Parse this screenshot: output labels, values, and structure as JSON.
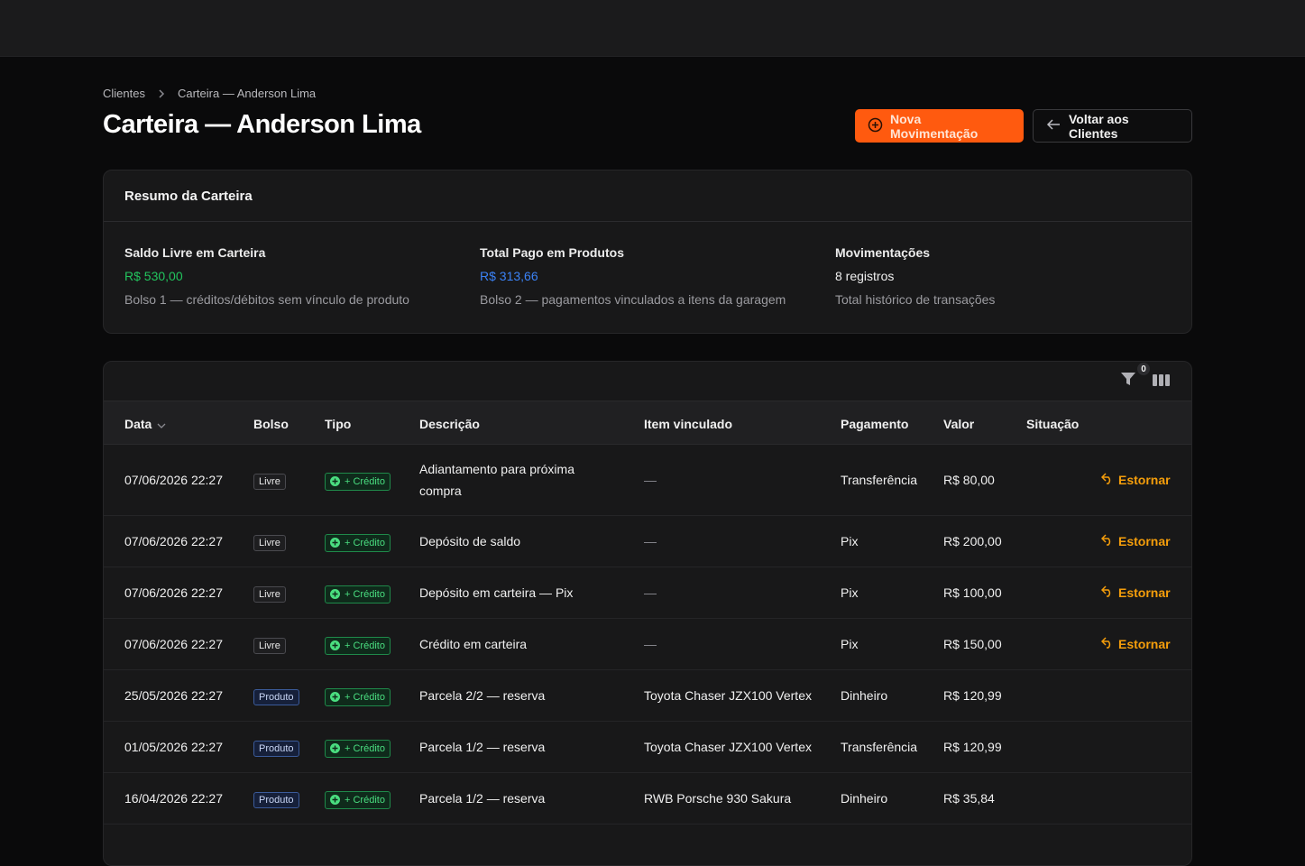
{
  "breadcrumb": {
    "root": "Clientes",
    "current": "Carteira — Anderson Lima"
  },
  "page_title": "Carteira — Anderson Lima",
  "actions": {
    "new_label": "Nova Movimentação",
    "back_label": "Voltar aos Clientes"
  },
  "summary": {
    "title": "Resumo da Carteira",
    "cols": [
      {
        "label": "Saldo Livre em Carteira",
        "value": "R$ 530,00",
        "desc": "Bolso 1 — créditos/débitos sem vínculo de produto"
      },
      {
        "label": "Total Pago em Produtos",
        "value": "R$ 313,66",
        "desc": "Bolso 2 — pagamentos vinculados a itens da garagem"
      },
      {
        "label": "Movimentações",
        "value": "8 registros",
        "desc": "Total histórico de transações"
      }
    ]
  },
  "toolbar": {
    "filter_count": "0"
  },
  "table": {
    "headers": [
      "Data",
      "Bolso",
      "Tipo",
      "Descrição",
      "Item vinculado",
      "Pagamento",
      "Valor",
      "Situação"
    ],
    "rows": [
      {
        "date": "07/06/2026 22:27",
        "bolso": "Livre",
        "tipo": "+ Crédito",
        "desc1": "Adiantamento para próxima",
        "desc2": "compra",
        "item": "—",
        "pagamento": "Transferência",
        "valor": "R$ 80,00",
        "action": "Estornar"
      },
      {
        "date": "07/06/2026 22:27",
        "bolso": "Livre",
        "tipo": "+ Crédito",
        "desc1": "Depósito de saldo",
        "desc2": "",
        "item": "—",
        "pagamento": "Pix",
        "valor": "R$ 200,00",
        "action": "Estornar"
      },
      {
        "date": "07/06/2026 22:27",
        "bolso": "Livre",
        "tipo": "+ Crédito",
        "desc1": "Depósito em carteira — Pix",
        "desc2": "",
        "item": "—",
        "pagamento": "Pix",
        "valor": "R$ 100,00",
        "action": "Estornar"
      },
      {
        "date": "07/06/2026 22:27",
        "bolso": "Livre",
        "tipo": "+ Crédito",
        "desc1": "Crédito em carteira",
        "desc2": "",
        "item": "—",
        "pagamento": "Pix",
        "valor": "R$ 150,00",
        "action": "Estornar"
      },
      {
        "date": "25/05/2026 22:27",
        "bolso": "Produto",
        "tipo": "+ Crédito",
        "desc1": "Parcela 2/2 — reserva",
        "desc2": "",
        "item": "Toyota Chaser JZX100 Vertex",
        "pagamento": "Dinheiro",
        "valor": "R$ 120,99",
        "action": ""
      },
      {
        "date": "01/05/2026 22:27",
        "bolso": "Produto",
        "tipo": "+ Crédito",
        "desc1": "Parcela 1/2 — reserva",
        "desc2": "",
        "item": "Toyota Chaser JZX100 Vertex",
        "pagamento": "Transferência",
        "valor": "R$ 120,99",
        "action": ""
      },
      {
        "date": "16/04/2026 22:27",
        "bolso": "Produto",
        "tipo": "+ Crédito",
        "desc1": "Parcela 1/2 — reserva",
        "desc2": "",
        "item": "RWB Porsche 930 Sakura",
        "pagamento": "Dinheiro",
        "valor": "R$ 35,84",
        "action": ""
      }
    ]
  },
  "colors": {
    "accent": "#ff5a0f",
    "green": "#22c55e",
    "blue": "#3b82f6",
    "amber": "#f59e0b"
  }
}
